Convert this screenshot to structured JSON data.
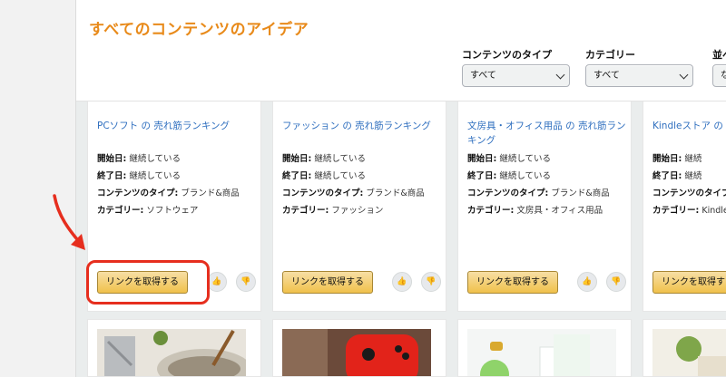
{
  "page": {
    "title": "すべてのコンテンツのアイデア"
  },
  "filters": [
    {
      "label": "コンテンツのタイプ",
      "value": "すべて"
    },
    {
      "label": "カテゴリー",
      "value": "すべて"
    },
    {
      "label": "並べ",
      "value": "な"
    }
  ],
  "field_labels": {
    "start": "開始日:",
    "end": "終了日:",
    "type": "コンテンツのタイプ:",
    "category": "カテゴリー:"
  },
  "cards": [
    {
      "title": "PCソフト の 売れ筋ランキング",
      "start": "継続している",
      "end": "継続している",
      "type": "ブランド&商品",
      "category": "ソフトウェア",
      "button": "リンクを取得する",
      "like": "👍",
      "dislike": "👎"
    },
    {
      "title": "ファッション の 売れ筋ランキング",
      "start": "継続している",
      "end": "継続している",
      "type": "ブランド&商品",
      "category": "ファッション",
      "button": "リンクを取得する",
      "like": "👍",
      "dislike": "👎"
    },
    {
      "title": "文房具・オフィス用品 の 売れ筋ランキング",
      "start": "継続している",
      "end": "継続している",
      "type": "ブランド&商品",
      "category": "文房具・オフィス用品",
      "button": "リンクを取得する",
      "like": "👍",
      "dislike": "👎"
    },
    {
      "title": "Kindleストア の 売",
      "start": "継続",
      "end": "継続",
      "type": "ブ",
      "category": "Kindle",
      "button": "リンクを取得する",
      "like": "👍",
      "dislike": "👎"
    }
  ],
  "colors": {
    "accent": "#e88a1a",
    "link": "#2f6fbf",
    "button": "#f0c14b",
    "annotation": "#e62e1e"
  }
}
